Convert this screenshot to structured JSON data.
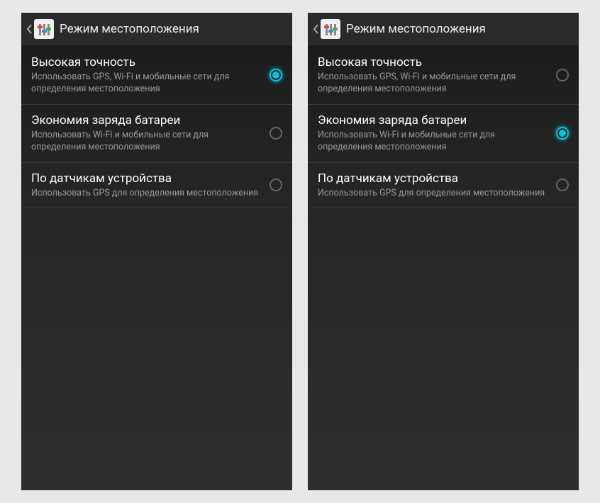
{
  "screens": [
    {
      "header": {
        "title": "Режим местоположения"
      },
      "options": [
        {
          "title": "Высокая точность",
          "desc": "Использовать GPS, Wi-Fi и мобильные сети для определения местоположения",
          "selected": true
        },
        {
          "title": "Экономия заряда батареи",
          "desc": "Использовать Wi-Fi и мобильные сети для определения местоположения",
          "selected": false
        },
        {
          "title": "По датчикам устройства",
          "desc": "Использовать GPS для определения местоположения",
          "selected": false
        }
      ]
    },
    {
      "header": {
        "title": "Режим местоположения"
      },
      "options": [
        {
          "title": "Высокая точность",
          "desc": "Использовать GPS, Wi-Fi и мобильные сети для определения местоположения",
          "selected": false
        },
        {
          "title": "Экономия заряда батареи",
          "desc": "Использовать Wi-Fi и мобильные сети для определения местоположения",
          "selected": true
        },
        {
          "title": "По датчикам устройства",
          "desc": "Использовать GPS для определения местоположения",
          "selected": false
        }
      ]
    }
  ]
}
